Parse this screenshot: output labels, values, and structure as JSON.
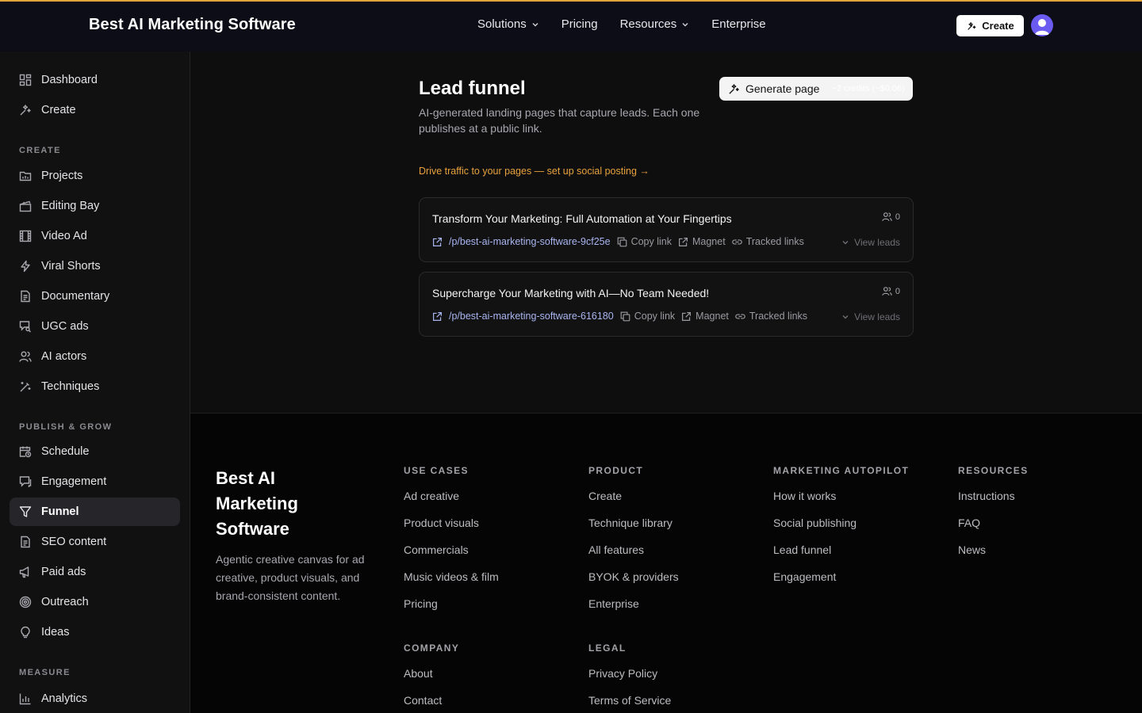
{
  "header": {
    "brand": "Best AI Marketing Software",
    "nav": [
      {
        "label": "Solutions",
        "has_menu": true
      },
      {
        "label": "Pricing",
        "has_menu": false
      },
      {
        "label": "Resources",
        "has_menu": true
      },
      {
        "label": "Enterprise",
        "has_menu": false
      }
    ],
    "create_label": "Create"
  },
  "sidebar": {
    "top_items": [
      {
        "label": "Dashboard",
        "icon": "dashboard-icon"
      },
      {
        "label": "Create",
        "icon": "sparkles-icon"
      }
    ],
    "sections": [
      {
        "heading": "CREATE",
        "items": [
          {
            "label": "Projects",
            "icon": "folder-icon"
          },
          {
            "label": "Editing Bay",
            "icon": "clapperboard-icon"
          },
          {
            "label": "Video Ad",
            "icon": "film-icon"
          },
          {
            "label": "Viral Shorts",
            "icon": "lightning-icon"
          },
          {
            "label": "Documentary",
            "icon": "document-icon"
          },
          {
            "label": "UGC ads",
            "icon": "chat-search-icon"
          },
          {
            "label": "AI actors",
            "icon": "users-icon"
          },
          {
            "label": "Techniques",
            "icon": "wand-icon"
          }
        ]
      },
      {
        "heading": "PUBLISH & GROW",
        "items": [
          {
            "label": "Schedule",
            "icon": "calendar-clock-icon"
          },
          {
            "label": "Engagement",
            "icon": "message-icon"
          },
          {
            "label": "Funnel",
            "icon": "funnel-icon",
            "active": true
          },
          {
            "label": "SEO content",
            "icon": "document-icon"
          },
          {
            "label": "Paid ads",
            "icon": "megaphone-icon"
          },
          {
            "label": "Outreach",
            "icon": "target-icon"
          },
          {
            "label": "Ideas",
            "icon": "lightbulb-icon"
          }
        ]
      },
      {
        "heading": "MEASURE",
        "items": [
          {
            "label": "Analytics",
            "icon": "bar-chart-icon"
          }
        ]
      }
    ]
  },
  "main": {
    "title": "Lead funnel",
    "description": "AI-generated landing pages that capture leads. Each one publishes at a public link.",
    "generate_label": "Generate page",
    "generate_credits": "~2 credits (~$0.06)",
    "traffic_link": "Drive traffic to your pages — set up social posting →",
    "pages": [
      {
        "title": "Transform Your Marketing: Full Automation at Your Fingertips",
        "slug": "/p/best-ai-marketing-software-9cf25e",
        "lead_count": "0",
        "copy_label": "Copy link",
        "magnet_label": "Magnet",
        "tracked_label": "Tracked links",
        "view_leads_label": "View leads"
      },
      {
        "title": "Supercharge Your Marketing with AI—No Team Needed!",
        "slug": "/p/best-ai-marketing-software-616180",
        "lead_count": "0",
        "copy_label": "Copy link",
        "magnet_label": "Magnet",
        "tracked_label": "Tracked links",
        "view_leads_label": "View leads"
      }
    ]
  },
  "footer": {
    "brand": "Best AI Marketing Software",
    "description": "Agentic creative canvas for ad creative, product visuals, and brand-consistent content.",
    "columns": [
      {
        "heading": "USE CASES",
        "links": [
          "Ad creative",
          "Product visuals",
          "Commercials",
          "Music videos & film",
          "Pricing"
        ]
      },
      {
        "heading": "PRODUCT",
        "links": [
          "Create",
          "Technique library",
          "All features",
          "BYOK & providers",
          "Enterprise"
        ]
      },
      {
        "heading": "MARKETING AUTOPILOT",
        "links": [
          "How it works",
          "Social publishing",
          "Lead funnel",
          "Engagement"
        ]
      },
      {
        "heading": "RESOURCES",
        "links": [
          "Instructions",
          "FAQ",
          "News"
        ]
      },
      {
        "heading": "COMPANY",
        "links": [
          "About",
          "Contact"
        ]
      },
      {
        "heading": "LEGAL",
        "links": [
          "Privacy Policy",
          "Terms of Service"
        ]
      }
    ]
  }
}
